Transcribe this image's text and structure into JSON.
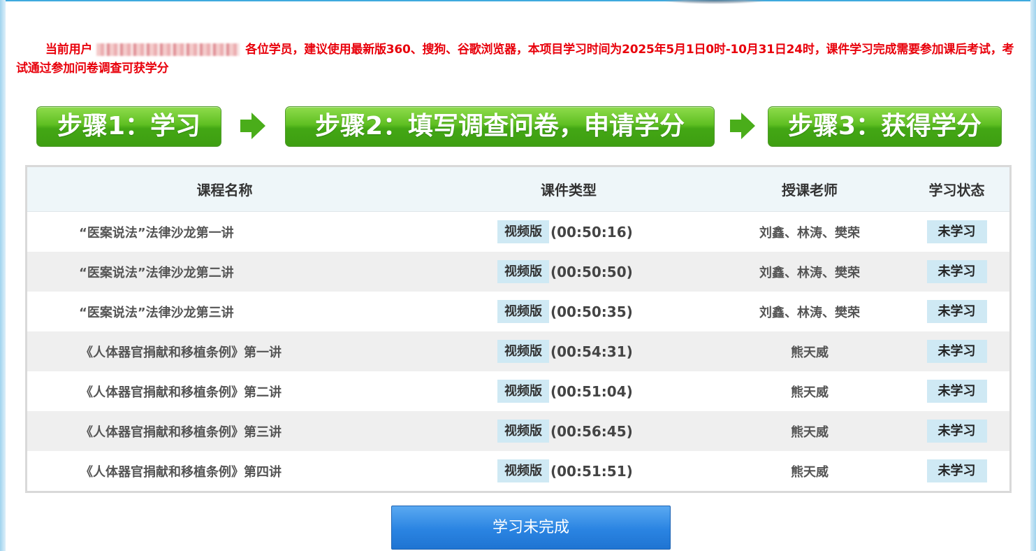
{
  "notice": {
    "prefix": "当前用户",
    "suffix": "各位学员，建议使用最新版360、搜狗、谷歌浏览器，本项目学习时间为2025年5月1日0时-10月31日24时，课件学习完成需要参加课后考试，考试通过参加问卷调查可获学分"
  },
  "steps": [
    {
      "label": "步骤1：学习"
    },
    {
      "label": "步骤2：填写调查问卷，申请学分"
    },
    {
      "label": "步骤3：获得学分"
    }
  ],
  "table": {
    "headers": {
      "name": "课程名称",
      "type": "课件类型",
      "teacher": "授课老师",
      "status": "学习状态"
    },
    "rows": [
      {
        "name": "“医案说法”法律沙龙第一讲",
        "type": "视频版",
        "duration": "(00:50:16)",
        "teacher": "刘鑫、林涛、樊荣",
        "status": "未学习"
      },
      {
        "name": "“医案说法”法律沙龙第二讲",
        "type": "视频版",
        "duration": "(00:50:50)",
        "teacher": "刘鑫、林涛、樊荣",
        "status": "未学习"
      },
      {
        "name": "“医案说法”法律沙龙第三讲",
        "type": "视频版",
        "duration": "(00:50:35)",
        "teacher": "刘鑫、林涛、樊荣",
        "status": "未学习"
      },
      {
        "name": "《人体器官捐献和移植条例》第一讲",
        "type": "视频版",
        "duration": "(00:54:31)",
        "teacher": "熊天威",
        "status": "未学习"
      },
      {
        "name": "《人体器官捐献和移植条例》第二讲",
        "type": "视频版",
        "duration": "(00:51:04)",
        "teacher": "熊天威",
        "status": "未学习"
      },
      {
        "name": "《人体器官捐献和移植条例》第三讲",
        "type": "视频版",
        "duration": "(00:56:45)",
        "teacher": "熊天威",
        "status": "未学习"
      },
      {
        "name": "《人体器官捐献和移植条例》第四讲",
        "type": "视频版",
        "duration": "(00:51:51)",
        "teacher": "熊天威",
        "status": "未学习"
      }
    ]
  },
  "submit_button": {
    "label": "学习未完成"
  },
  "colors": {
    "notice": "#e8000b",
    "step_green": "#4caf1e",
    "button_blue": "#2a84e2",
    "tag_bg": "#cfe9f4"
  }
}
